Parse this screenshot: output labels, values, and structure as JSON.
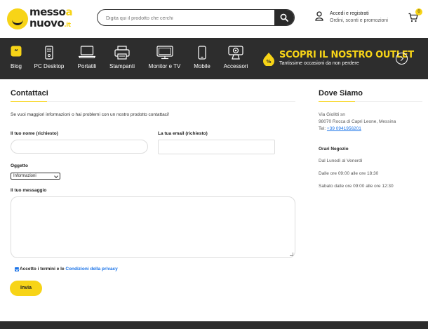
{
  "header": {
    "logo": {
      "line1": "messo",
      "line1_accent": "a",
      "line2": "nuovo",
      "line2_suffix": ".it"
    },
    "search": {
      "placeholder": "Digita qui il prodotto che cerchi",
      "icon": "search-icon"
    },
    "account": {
      "title": "Accedi e registrati",
      "subtitle": "Ordini, sconti e promozioni",
      "icon": "user-icon"
    },
    "cart": {
      "count": "0",
      "icon": "cart-icon"
    }
  },
  "nav": {
    "items": [
      {
        "label": "Blog",
        "icon": "blog-icon"
      },
      {
        "label": "PC Desktop",
        "icon": "pc-desktop-icon"
      },
      {
        "label": "Portatili",
        "icon": "laptop-icon"
      },
      {
        "label": "Stampanti",
        "icon": "printer-icon"
      },
      {
        "label": "Monitor e TV",
        "icon": "monitor-icon"
      },
      {
        "label": "Mobile",
        "icon": "smartphone-icon"
      },
      {
        "label": "Accessori",
        "icon": "webcam-icon"
      }
    ],
    "outlet": {
      "title": "SCOPRI IL NOSTRO OUTLET",
      "subtitle": "Tantissime occasioni da non perdere",
      "badge": "%"
    }
  },
  "contact": {
    "title": "Contattaci",
    "intro": "Se vuoi maggiori informazioni o hai problemi con un nostro prodotto contattaci!",
    "name_label": "Il tuo nome (richiesto)",
    "name_value": "",
    "email_label": "La tua email (richiesto)",
    "email_value": "",
    "subject_label": "Oggetto",
    "subject_selected": "Informazioni",
    "message_label": "Il tuo messaggio",
    "message_value": "",
    "terms_text": "Accetto i termini e le ",
    "terms_link": "Condizioni della privacy",
    "terms_checked": true,
    "submit_label": "Invia"
  },
  "location": {
    "title": "Dove Siamo",
    "address1": "Via Giolitti sn",
    "address2": "98070 Rocca di Capri Leone, Messina",
    "phone_prefix": "Tel: ",
    "phone": "+39 0941956201",
    "hours_title": "Orari Negozio",
    "days": "Dal Lunedì al Venerdì",
    "weekday_hours": "Dalle ore 09:00 alle ore 18:30",
    "saturday_hours": "Sabato dalle ore 09:00 alle ore 12:30"
  },
  "colors": {
    "accent": "#f7d417",
    "dark": "#2d2d2d",
    "link": "#1a73e8"
  }
}
